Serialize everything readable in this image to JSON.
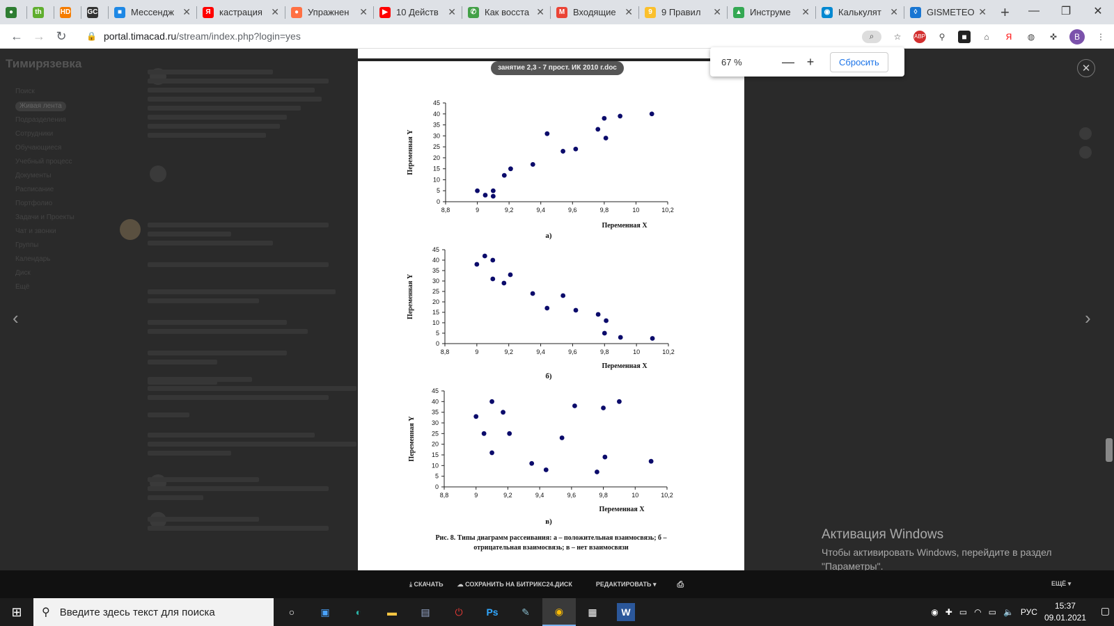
{
  "browser": {
    "tabs": [
      {
        "icon": "timacad-icon",
        "title": "",
        "color": "#2e7d32",
        "glyph": "●"
      },
      {
        "icon": "th-icon",
        "title": "",
        "color": "#5fae2e",
        "glyph": "th"
      },
      {
        "icon": "hd-icon",
        "title": "",
        "color": "#f57c00",
        "glyph": "HD"
      },
      {
        "icon": "gc-icon",
        "title": "",
        "color": "#333333",
        "glyph": "GC"
      },
      {
        "icon": "messenger-icon",
        "title": "Мессендж",
        "color": "#1e88e5",
        "glyph": "■"
      },
      {
        "icon": "yandex-icon",
        "title": "кастрация",
        "color": "#ff0000",
        "glyph": "Я"
      },
      {
        "icon": "orange-icon",
        "title": "Упражнен",
        "color": "#ff7043",
        "glyph": "●"
      },
      {
        "icon": "youtube-icon",
        "title": "10 Действ",
        "color": "#ff0000",
        "glyph": "▶"
      },
      {
        "icon": "phone-icon",
        "title": "Как восста",
        "color": "#43a047",
        "glyph": "✆"
      },
      {
        "icon": "gmail-icon",
        "title": "Входящие",
        "color": "#ea4335",
        "glyph": "M"
      },
      {
        "icon": "number-icon",
        "title": "9 Правил",
        "color": "#fbc02d",
        "glyph": "9"
      },
      {
        "icon": "drive-icon",
        "title": "Инструме",
        "color": "#34a853",
        "glyph": "▲"
      },
      {
        "icon": "calc-icon",
        "title": "Калькулят",
        "color": "#0288d1",
        "glyph": "◉"
      },
      {
        "icon": "gismeteo-icon",
        "title": "GISMETEO",
        "color": "#1976d2",
        "glyph": "◊"
      }
    ],
    "url_host": "portal.timacad.ru",
    "url_path": "/stream/index.php?login=yes",
    "zoom": {
      "value": "67 %",
      "minus": "—",
      "plus": "+",
      "reset": "Сбросить"
    },
    "profile_letter": "B"
  },
  "viewer": {
    "doc_name": "занятие 2,3 - 7 прост. ИК 2010 г.doc",
    "actions": {
      "download": "СКАЧАТЬ",
      "save": "СОХРАНИТЬ НА БИТРИКС24.ДИСК",
      "edit": "РЕДАКТИРОВАТЬ",
      "more": "ЕЩЁ"
    },
    "caption_line1": "Рис. 8. Типы диаграмм рассеивания:  а – положительная взаимосвязь; б –",
    "caption_line2": "отрицательная взаимосвязь; в – нет взаимосвязи"
  },
  "background": {
    "site_title": "Тимирязевка",
    "menu": [
      "Поиск",
      "Живая лента",
      "Подразделения",
      "Сотрудники",
      "Обучающиеся",
      "Учебный процесс",
      "Документы",
      "Расписание",
      "Портфолио",
      "Задачи и Проекты",
      "Чат и звонки",
      "Группы",
      "Календарь",
      "Диск",
      "Ещё"
    ]
  },
  "windows_activation": {
    "title": "Активация Windows",
    "line1": "Чтобы активировать Windows, перейдите в раздел",
    "line2": "\"Параметры\"."
  },
  "taskbar": {
    "search_placeholder": "Введите здесь текст для поиска",
    "lang": "РУС",
    "time": "15:37",
    "date": "09.01.2021"
  },
  "chart_data": [
    {
      "type": "scatter",
      "title": "а)",
      "xlabel": "Переменная X",
      "ylabel": "Переменная Y",
      "xlim": [
        8.8,
        10.2
      ],
      "ylim": [
        0,
        45
      ],
      "xticks": [
        "8,8",
        "9",
        "9,2",
        "9,4",
        "9,6",
        "9,8",
        "10",
        "10,2"
      ],
      "yticks": [
        "0",
        "5",
        "10",
        "15",
        "20",
        "25",
        "30",
        "35",
        "40",
        "45"
      ],
      "points": [
        [
          9.0,
          5
        ],
        [
          9.05,
          3
        ],
        [
          9.1,
          5
        ],
        [
          9.1,
          2.5
        ],
        [
          9.17,
          12
        ],
        [
          9.21,
          15
        ],
        [
          9.35,
          17
        ],
        [
          9.44,
          31
        ],
        [
          9.54,
          23
        ],
        [
          9.62,
          24
        ],
        [
          9.76,
          33
        ],
        [
          9.8,
          38
        ],
        [
          9.81,
          29
        ],
        [
          9.9,
          39
        ],
        [
          10.1,
          40
        ]
      ]
    },
    {
      "type": "scatter",
      "title": "б)",
      "xlabel": "Переменная X",
      "ylabel": "Переменная Y",
      "xlim": [
        8.8,
        10.2
      ],
      "ylim": [
        0,
        45
      ],
      "xticks": [
        "8,8",
        "9",
        "9,2",
        "9,4",
        "9,6",
        "9,8",
        "10",
        "10,2"
      ],
      "yticks": [
        "0",
        "5",
        "10",
        "15",
        "20",
        "25",
        "30",
        "35",
        "40",
        "45"
      ],
      "points": [
        [
          9.0,
          38
        ],
        [
          9.05,
          42
        ],
        [
          9.1,
          40
        ],
        [
          9.1,
          31
        ],
        [
          9.17,
          29
        ],
        [
          9.21,
          33
        ],
        [
          9.35,
          24
        ],
        [
          9.44,
          17
        ],
        [
          9.54,
          23
        ],
        [
          9.62,
          16
        ],
        [
          9.76,
          14
        ],
        [
          9.8,
          5
        ],
        [
          9.81,
          11
        ],
        [
          9.9,
          3
        ],
        [
          10.1,
          2.5
        ]
      ]
    },
    {
      "type": "scatter",
      "title": "в)",
      "xlabel": "Переменная X",
      "ylabel": "Переменная Y",
      "xlim": [
        8.8,
        10.2
      ],
      "ylim": [
        0,
        45
      ],
      "xticks": [
        "8,8",
        "9",
        "9,2",
        "9,4",
        "9,6",
        "9,8",
        "10",
        "10,2"
      ],
      "yticks": [
        "0",
        "5",
        "10",
        "15",
        "20",
        "25",
        "30",
        "35",
        "40",
        "45"
      ],
      "points": [
        [
          9.0,
          33
        ],
        [
          9.05,
          25
        ],
        [
          9.1,
          40
        ],
        [
          9.1,
          16
        ],
        [
          9.17,
          35
        ],
        [
          9.21,
          25
        ],
        [
          9.35,
          11
        ],
        [
          9.44,
          8
        ],
        [
          9.54,
          23
        ],
        [
          9.62,
          38
        ],
        [
          9.76,
          7
        ],
        [
          9.8,
          37
        ],
        [
          9.81,
          14
        ],
        [
          9.9,
          40
        ],
        [
          10.1,
          12
        ]
      ]
    }
  ]
}
